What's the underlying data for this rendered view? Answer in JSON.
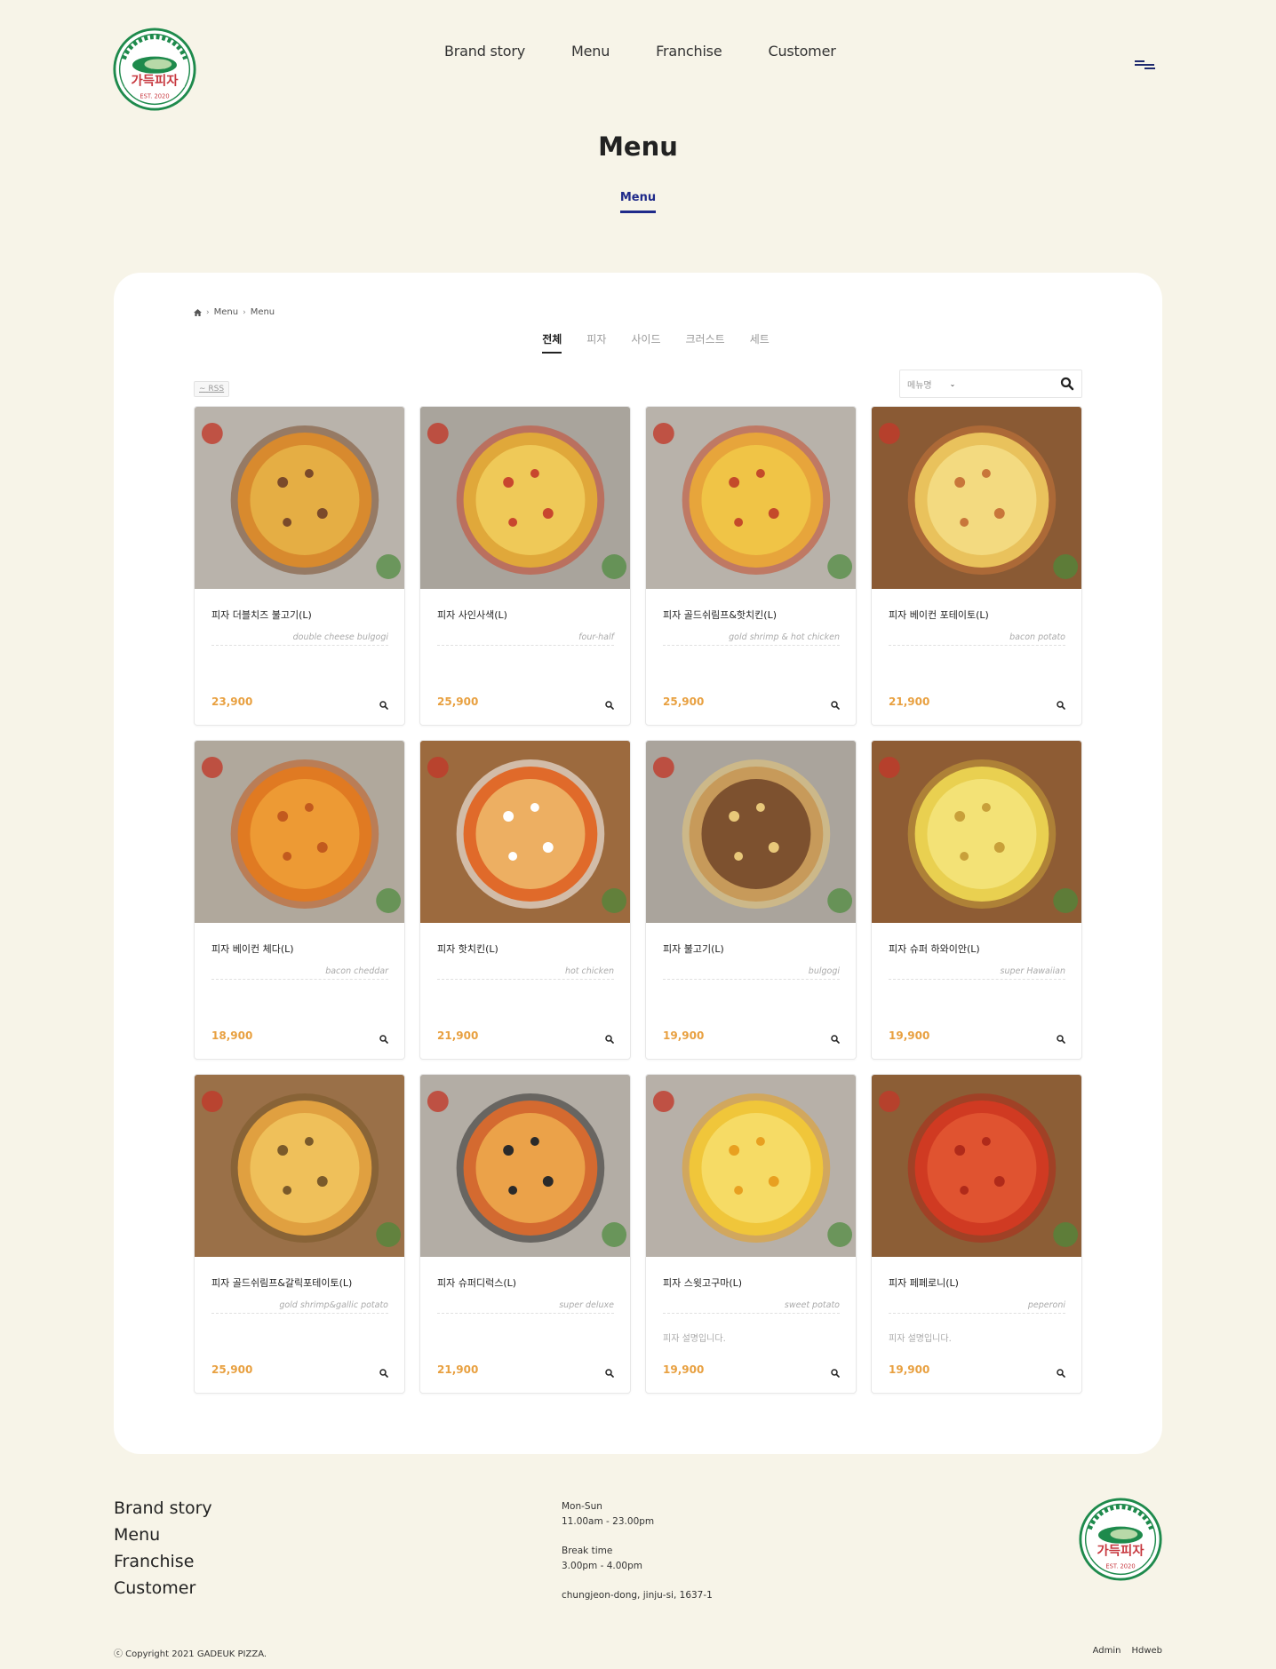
{
  "brand": {
    "logo_text": "가득피자",
    "logo_est": "EST. 2020",
    "colors": {
      "green": "#1e8a4c",
      "red": "#c7383f",
      "navy": "#1f2a8a",
      "price": "#e8a040",
      "background": "#f7f4e8"
    }
  },
  "header": {
    "nav": [
      "Brand story",
      "Menu",
      "Franchise",
      "Customer"
    ],
    "menu_icon": "hamburger-icon"
  },
  "page": {
    "title": "Menu",
    "subtab": "Menu"
  },
  "breadcrumb": {
    "home_icon": "home-icon",
    "items": [
      "Menu",
      "Menu"
    ]
  },
  "category_tabs": [
    {
      "label": "전체",
      "active": true
    },
    {
      "label": "피자",
      "active": false
    },
    {
      "label": "사이드",
      "active": false
    },
    {
      "label": "크러스트",
      "active": false
    },
    {
      "label": "세트",
      "active": false
    }
  ],
  "rss": {
    "label": "RSS",
    "icon": "rss-icon"
  },
  "search": {
    "select_value": "메뉴명",
    "input_value": "",
    "button_icon": "search-icon"
  },
  "products": [
    {
      "name": "피자 더블치즈 불고기(L)",
      "eng": "double cheese bulgogi",
      "desc": "",
      "price": "23,900"
    },
    {
      "name": "피자 사인사색(L)",
      "eng": "four-half",
      "desc": "",
      "price": "25,900"
    },
    {
      "name": "피자 골드쉬림프&핫치킨(L)",
      "eng": "gold shrimp & hot chicken",
      "desc": "",
      "price": "25,900"
    },
    {
      "name": "피자 베이컨 포테이토(L)",
      "eng": "bacon potato",
      "desc": "",
      "price": "21,900"
    },
    {
      "name": "피자 베이컨 체다(L)",
      "eng": "bacon cheddar",
      "desc": "",
      "price": "18,900"
    },
    {
      "name": "피자 핫치킨(L)",
      "eng": "hot chicken",
      "desc": "",
      "price": "21,900"
    },
    {
      "name": "피자 불고기(L)",
      "eng": "bulgogi",
      "desc": "",
      "price": "19,900"
    },
    {
      "name": "피자 슈퍼 하와이안(L)",
      "eng": "super Hawaiian",
      "desc": "",
      "price": "19,900"
    },
    {
      "name": "피자 골드쉬림프&갈릭포테이토(L)",
      "eng": "gold shrimp&gallic potato",
      "desc": "",
      "price": "25,900"
    },
    {
      "name": "피자 슈퍼디럭스(L)",
      "eng": "super deluxe",
      "desc": "",
      "price": "21,900"
    },
    {
      "name": "피자 스윗고구마(L)",
      "eng": "sweet potato",
      "desc": "피자 설명입니다.",
      "price": "19,900"
    },
    {
      "name": "피자 페페로니(L)",
      "eng": "peperoni",
      "desc": "피자 설명입니다.",
      "price": "19,900"
    }
  ],
  "footer": {
    "nav": [
      "Brand story",
      "Menu",
      "Franchise",
      "Customer"
    ],
    "hours_label": "Mon-Sun",
    "hours": "11.00am - 23.00pm",
    "break_label": "Break time",
    "break_hours": "3.00pm - 4.00pm",
    "address": "chungjeon-dong, jinju-si, 1637-1",
    "copyright": "ⓒ Copyright 2021 GADEUK PIZZA.",
    "links": [
      "Admin",
      "Hdweb"
    ]
  }
}
